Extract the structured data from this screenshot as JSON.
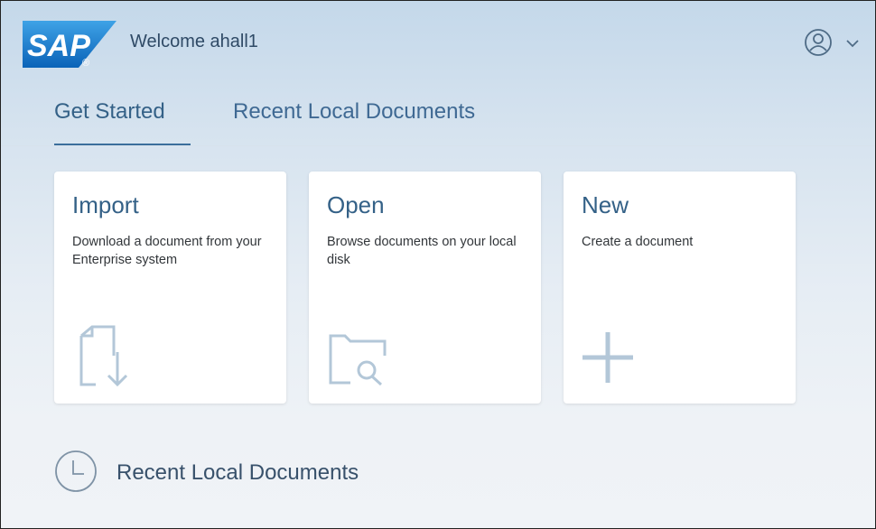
{
  "header": {
    "brand": "SAP",
    "welcome": "Welcome ahall1",
    "user_icon": "user-avatar-icon",
    "menu_icon": "chevron-down-icon"
  },
  "tabs": [
    {
      "label": "Get Started",
      "active": true
    },
    {
      "label": "Recent Local Documents",
      "active": false
    }
  ],
  "tiles": [
    {
      "title": "Import",
      "description": "Download a document from your Enterprise system",
      "icon": "document-download-icon"
    },
    {
      "title": "Open",
      "description": "Browse documents on your local disk",
      "icon": "folder-search-icon"
    },
    {
      "title": "New",
      "description": "Create a document",
      "icon": "add-icon"
    }
  ],
  "recent_section": {
    "label": "Recent Local Documents",
    "icon": "clock-icon"
  },
  "colors": {
    "accent": "#346187",
    "icon_muted": "#b3c7d8",
    "brand_blue": "#1a73c9"
  }
}
